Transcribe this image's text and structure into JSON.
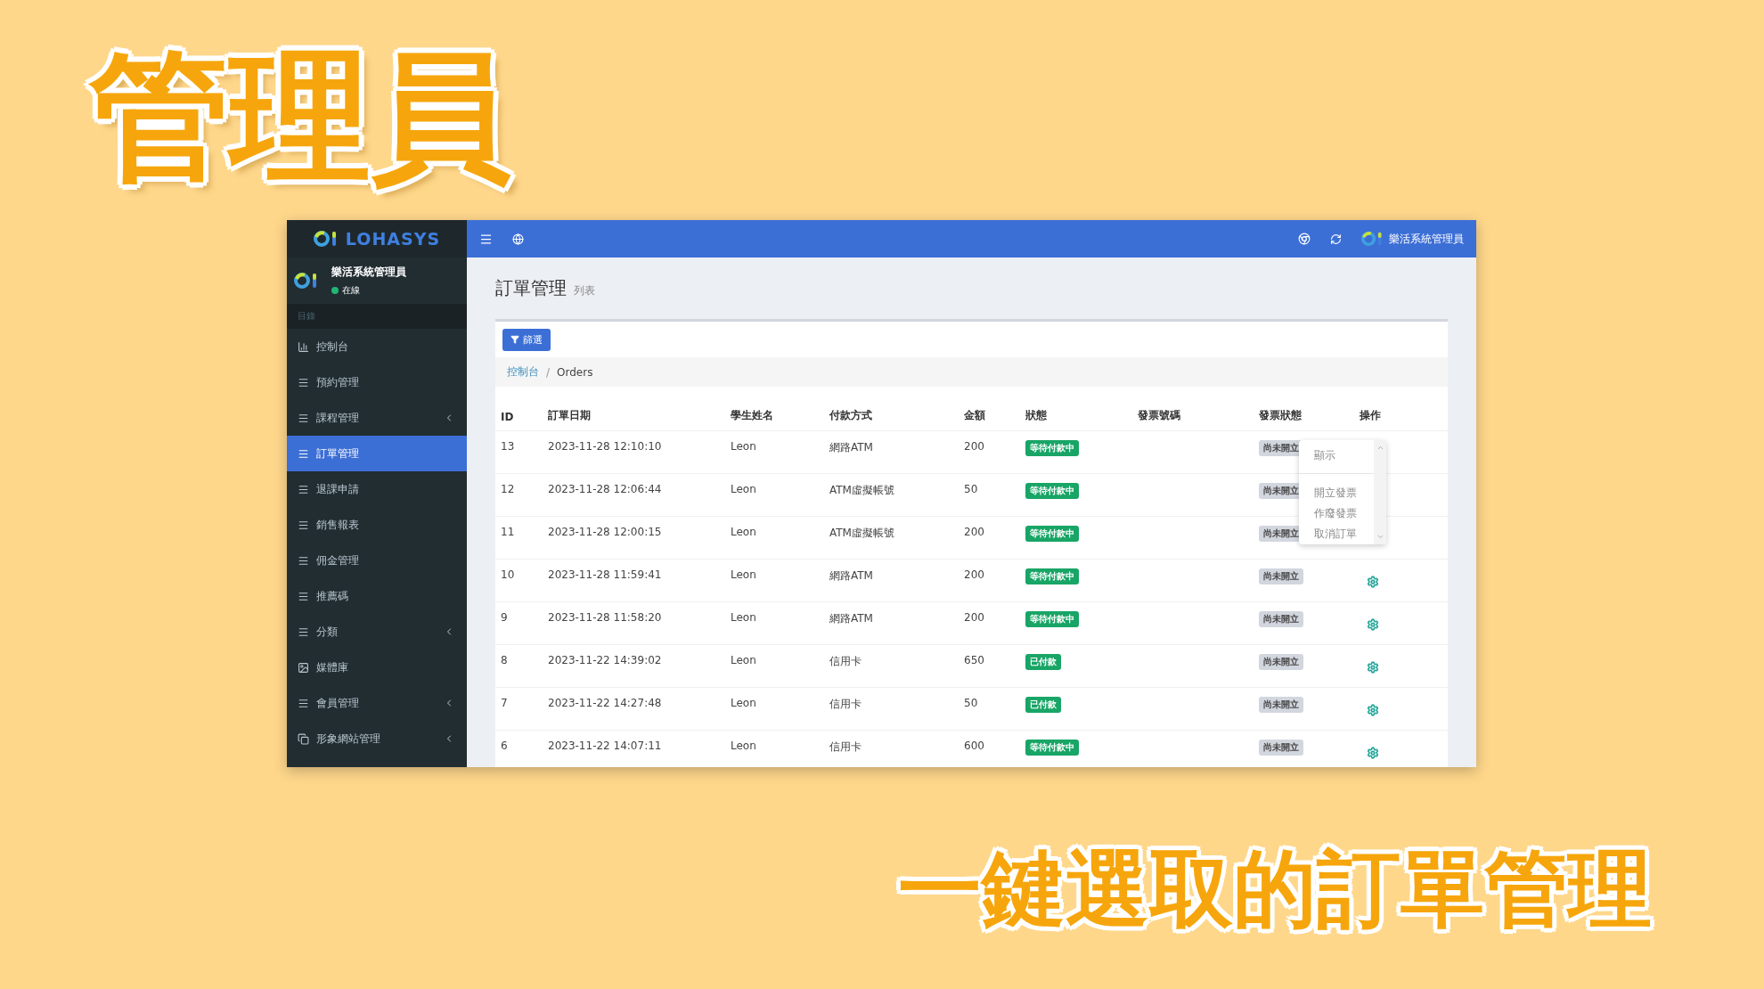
{
  "slide_title": "管理員",
  "slide_caption": "一鍵選取的訂單管理",
  "window": {
    "sidebar": {
      "brand": "LOHASYS",
      "user": {
        "name": "樂活系統管理員",
        "status": "在線",
        "online": true
      },
      "section": "目錄",
      "items": [
        {
          "label": "控制台",
          "kind": "chart",
          "selected": false,
          "expandable": false
        },
        {
          "label": "預約管理",
          "kind": "list",
          "selected": false,
          "expandable": false
        },
        {
          "label": "課程管理",
          "kind": "list",
          "selected": false,
          "expandable": true
        },
        {
          "label": "訂單管理",
          "kind": "list",
          "selected": true,
          "expandable": false
        },
        {
          "label": "退課申請",
          "kind": "list",
          "selected": false,
          "expandable": false
        },
        {
          "label": "銷售報表",
          "kind": "list",
          "selected": false,
          "expandable": false
        },
        {
          "label": "佣金管理",
          "kind": "list",
          "selected": false,
          "expandable": false
        },
        {
          "label": "推薦碼",
          "kind": "list",
          "selected": false,
          "expandable": false
        },
        {
          "label": "分類",
          "kind": "list",
          "selected": false,
          "expandable": true
        },
        {
          "label": "媒體庫",
          "kind": "image",
          "selected": false,
          "expandable": false
        },
        {
          "label": "會員管理",
          "kind": "list",
          "selected": false,
          "expandable": true
        },
        {
          "label": "形象網站管理",
          "kind": "copy",
          "selected": false,
          "expandable": true
        }
      ]
    },
    "topbar": {
      "user": "樂活系統管理員"
    },
    "page": {
      "title": "訂單管理",
      "subtitle": "列表",
      "filter_button": "篩選",
      "breadcrumb": {
        "link": "控制台",
        "separator": "/",
        "current": "Orders"
      }
    },
    "table": {
      "columns": [
        "ID",
        "訂單日期",
        "學生姓名",
        "付款方式",
        "金額",
        "狀態",
        "發票號碼",
        "發票狀態",
        "操作"
      ],
      "rows": [
        {
          "id": "13",
          "date": "2023-11-28 12:10:10",
          "name": "Leon",
          "payment": "網路ATM",
          "amount": "200",
          "status": "等待付款中",
          "invoice_status": "尚未開立",
          "gear": false,
          "menu": [
            "顯示",
            "開立發票",
            "作廢發票",
            "取消訂單"
          ]
        },
        {
          "id": "12",
          "date": "2023-11-28 12:06:44",
          "name": "Leon",
          "payment": "ATM虛擬帳號",
          "amount": "50",
          "status": "等待付款中",
          "invoice_status": "尚未開立",
          "gear": false
        },
        {
          "id": "11",
          "date": "2023-11-28 12:00:15",
          "name": "Leon",
          "payment": "ATM虛擬帳號",
          "amount": "200",
          "status": "等待付款中",
          "invoice_status": "尚未開立",
          "gear": false
        },
        {
          "id": "10",
          "date": "2023-11-28 11:59:41",
          "name": "Leon",
          "payment": "網路ATM",
          "amount": "200",
          "status": "等待付款中",
          "invoice_status": "尚未開立",
          "gear": true
        },
        {
          "id": "9",
          "date": "2023-11-28 11:58:20",
          "name": "Leon",
          "payment": "網路ATM",
          "amount": "200",
          "status": "等待付款中",
          "invoice_status": "尚未開立",
          "gear": true
        },
        {
          "id": "8",
          "date": "2023-11-22 14:39:02",
          "name": "Leon",
          "payment": "信用卡",
          "amount": "650",
          "status": "已付款",
          "invoice_status": "尚未開立",
          "gear": true
        },
        {
          "id": "7",
          "date": "2023-11-22 14:27:48",
          "name": "Leon",
          "payment": "信用卡",
          "amount": "50",
          "status": "已付款",
          "invoice_status": "尚未開立",
          "gear": true
        },
        {
          "id": "6",
          "date": "2023-11-22 14:07:11",
          "name": "Leon",
          "payment": "信用卡",
          "amount": "600",
          "status": "等待付款中",
          "invoice_status": "尚未開立",
          "gear": true
        }
      ]
    }
  }
}
